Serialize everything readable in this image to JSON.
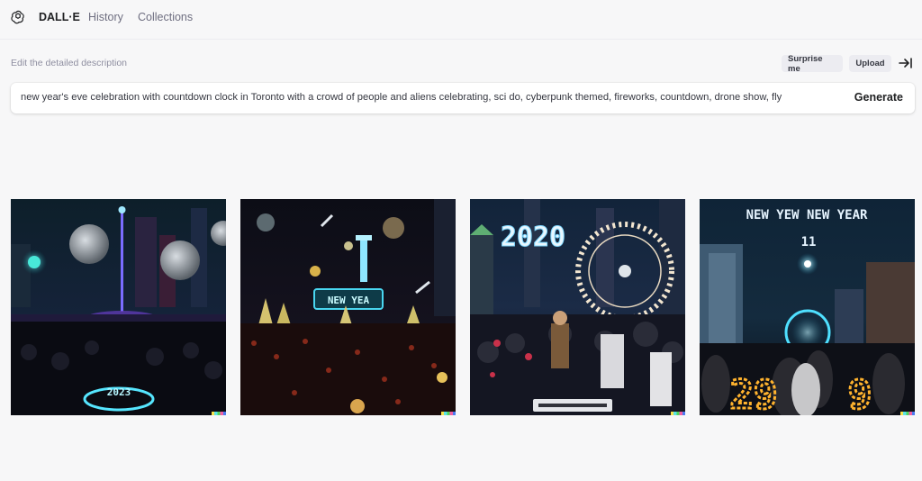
{
  "header": {
    "brand": "DALL·E",
    "nav": [
      "History",
      "Collections"
    ]
  },
  "editor": {
    "label": "Edit the detailed description",
    "surprise_label": "Surprise me",
    "upload_label": "Upload",
    "prompt_text": "new year's eve celebration with countdown clock in Toronto with a crowd of people and aliens celebrating, sci do, cyberpunk themed, fireworks, countdown, drone show, fly",
    "generate_label": "Generate"
  },
  "images": [
    {
      "overlay_text": "2023"
    },
    {
      "overlay_text": "NEW YEA"
    },
    {
      "overlay_text": "2020"
    },
    {
      "overlay_text": "NEW YEW  NEW YEAR",
      "overlay_sub": "11",
      "overlay_big": "29"
    }
  ],
  "colors": {
    "background": "#f7f7f8",
    "text_primary": "#202123",
    "text_secondary": "#6e6e80",
    "button_bg": "#ececf1"
  }
}
